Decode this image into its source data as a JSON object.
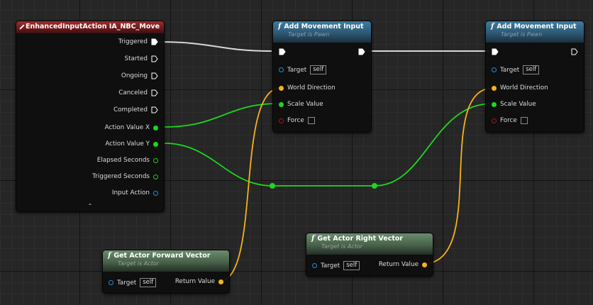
{
  "event_node": {
    "title": "EnhancedInputAction IA_NBC_Move",
    "pins": [
      "Triggered",
      "Started",
      "Ongoing",
      "Canceled",
      "Completed",
      "Action Value X",
      "Action Value Y",
      "Elapsed Seconds",
      "Triggered Seconds",
      "Input Action"
    ],
    "collapse_glyph": "⌃"
  },
  "add_movement_1": {
    "title": "Add Movement Input",
    "subtitle": "Target is Pawn",
    "target_label": "Target",
    "target_value": "self",
    "world_direction_label": "World Direction",
    "scale_value_label": "Scale Value",
    "force_label": "Force"
  },
  "add_movement_2": {
    "title": "Add Movement Input",
    "subtitle": "Target is Pawn",
    "target_label": "Target",
    "target_value": "self",
    "world_direction_label": "World Direction",
    "scale_value_label": "Scale Value",
    "force_label": "Force"
  },
  "get_forward": {
    "title": "Get Actor Forward Vector",
    "subtitle": "Target is Actor",
    "target_label": "Target",
    "target_value": "self",
    "return_label": "Return Value"
  },
  "get_right": {
    "title": "Get Actor Right Vector",
    "subtitle": "Target is Actor",
    "target_label": "Target",
    "target_value": "self",
    "return_label": "Return Value"
  },
  "colors": {
    "exec": "#ffffff",
    "float": "#1fd61f",
    "vector": "#f4b21b",
    "object": "#1f8ed8",
    "bool": "#9c1b1b",
    "event_header": "#a12c2c",
    "function_header_blue": "#3e7c9e",
    "function_header_green": "#6b8c6d"
  },
  "icons": {
    "event": "event-diamond-icon",
    "function": "function-f-icon"
  }
}
